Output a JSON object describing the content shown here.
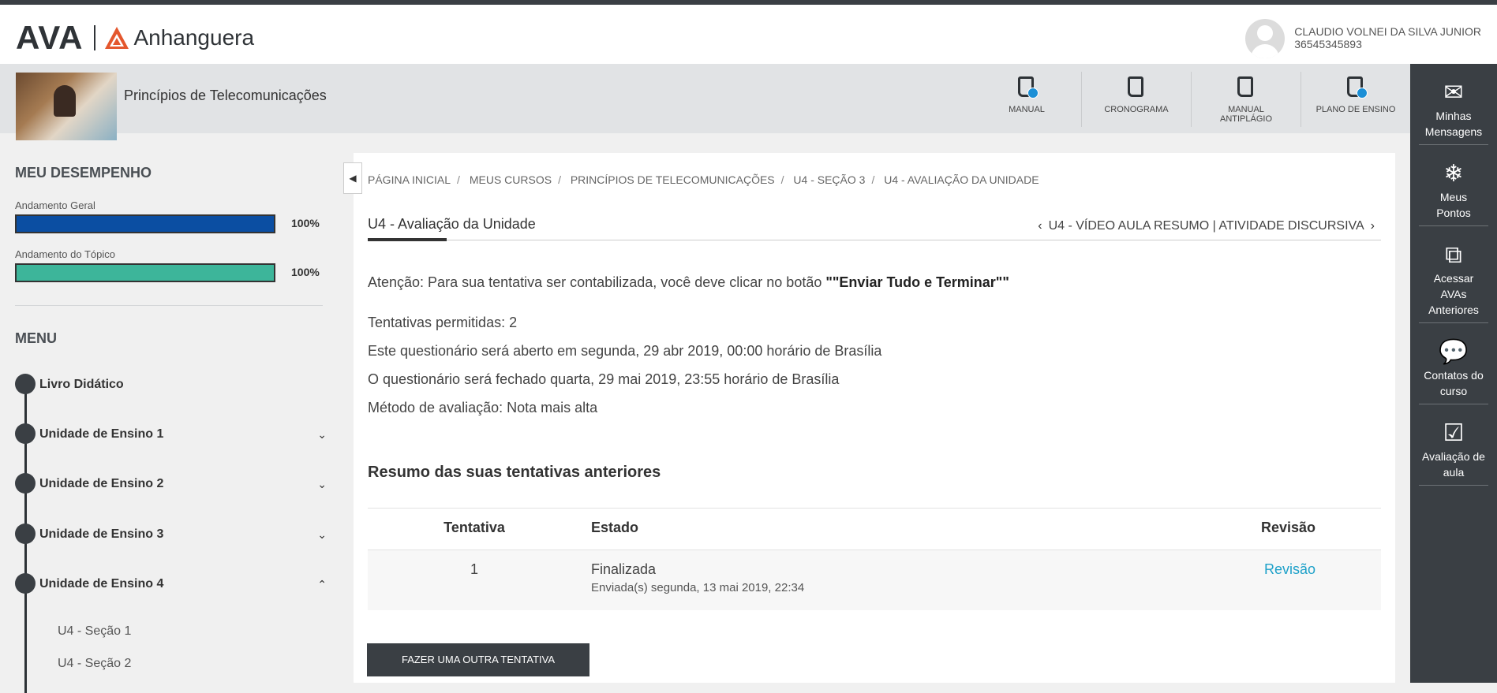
{
  "header": {
    "logo_ava": "AVA",
    "logo_brand": "Anhanguera",
    "user_name": "CLAUDIO VOLNEI DA SILVA JUNIOR",
    "user_id": "36545345893"
  },
  "course": {
    "title": "Princípios de Telecomunicações",
    "tools": [
      {
        "label_line1": "MANUAL",
        "label_line2": "",
        "icon": "book-check-icon"
      },
      {
        "label_line1": "CRONOGRAMA",
        "label_line2": "",
        "icon": "book-icon"
      },
      {
        "label_line1": "MANUAL",
        "label_line2": "ANTIPLÁGIO",
        "icon": "book-icon"
      },
      {
        "label_line1": "PLANO DE ENSINO",
        "label_line2": "",
        "icon": "book-check-icon"
      }
    ]
  },
  "rightbar": {
    "items": [
      {
        "line1": "Minhas",
        "line2": "Mensagens",
        "line3": "",
        "icon": "envelope-icon"
      },
      {
        "line1": "Meus",
        "line2": "Pontos",
        "line3": "",
        "icon": "snowflake-icon"
      },
      {
        "line1": "Acessar",
        "line2": "AVAs",
        "line3": "Anteriores",
        "icon": "external-link-icon"
      },
      {
        "line1": "Contatos do",
        "line2": "curso",
        "line3": "",
        "icon": "chat-icon"
      },
      {
        "line1": "Avaliação de",
        "line2": "aula",
        "line3": "",
        "icon": "calendar-check-icon"
      }
    ]
  },
  "sidebar": {
    "performance_title": "MEU DESEMPENHO",
    "overall_label": "Andamento Geral",
    "overall_value": "100%",
    "overall_fraction": 1.0,
    "overall_color": "#0b4ea2",
    "topic_label": "Andamento do Tópico",
    "topic_value": "100%",
    "topic_fraction": 1.0,
    "topic_color": "#3db59a",
    "menu_title": "MENU",
    "menu": [
      {
        "label": "Livro Didático",
        "chevron": ""
      },
      {
        "label": "Unidade de Ensino 1",
        "chevron": "⌄"
      },
      {
        "label": "Unidade de Ensino 2",
        "chevron": "⌄"
      },
      {
        "label": "Unidade de Ensino 3",
        "chevron": "⌄"
      },
      {
        "label": "Unidade de Ensino 4",
        "chevron": "⌃"
      }
    ],
    "submenu": [
      "U4 - Seção 1",
      "U4 - Seção 2"
    ]
  },
  "breadcrumb": [
    "PÁGINA INICIAL",
    "MEUS CURSOS",
    "PRINCÍPIOS DE TELECOMUNICAÇÕES",
    "U4 - SEÇÃO 3",
    "U4 - AVALIAÇÃO DA UNIDADE"
  ],
  "main": {
    "title": "U4 - Avaliação da Unidade",
    "next_nav": "U4 - VÍDEO AULA RESUMO | ATIVIDADE DISCURSIVA",
    "attention_prefix": "Atenção: Para sua tentativa ser contabilizada, você deve clicar no botão ",
    "attention_bold": "\"\"Enviar Tudo e Terminar\"\"",
    "attempts_allowed": "Tentativas permitidas: 2",
    "opens": "Este questionário será aberto em segunda, 29 abr 2019, 00:00 horário de Brasília",
    "closes": "O questionário será fechado quarta, 29 mai 2019, 23:55 horário de Brasília",
    "method": "Método de avaliação: Nota mais alta",
    "summary_title": "Resumo das suas tentativas anteriores",
    "table": {
      "headers": [
        "Tentativa",
        "Estado",
        "Revisão"
      ],
      "rows": [
        {
          "attempt": "1",
          "state": "Finalizada",
          "sent": "Enviada(s) segunda, 13 mai 2019, 22:34",
          "review": "Revisão"
        }
      ]
    },
    "retry_button": "FAZER UMA OUTRA TENTATIVA"
  }
}
